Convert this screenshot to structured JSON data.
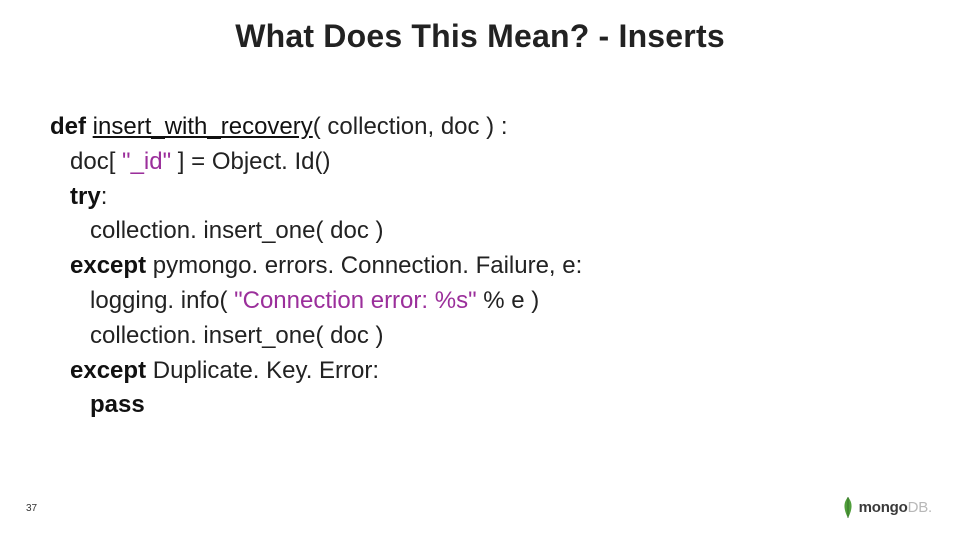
{
  "title": "What Does This Mean? - Inserts",
  "code": {
    "l1": {
      "kw": "def ",
      "fn": "insert_with_recovery",
      "rest": "( collection, doc ) :"
    },
    "l2": {
      "pre": "   doc[ ",
      "str": "\"_id\"",
      "post": " ] = Object. Id()"
    },
    "l3": {
      "kw": "try",
      "rest": ":"
    },
    "l4": "      collection. insert_one( doc )",
    "l5": {
      "kw": "except ",
      "rest": "pymongo. errors. Connection. Failure, e:"
    },
    "l6": {
      "pre": "      logging. info( ",
      "str": "\"Connection error: %s\"",
      "post": " % e )"
    },
    "l7": "      collection. insert_one( doc )",
    "l8": {
      "kw": "except ",
      "rest": "Duplicate. Key. Error:"
    },
    "l9": {
      "kw": "pass"
    }
  },
  "page_number": "37",
  "logo": {
    "bold": "mongo",
    "light": "DB",
    "dot": "."
  }
}
